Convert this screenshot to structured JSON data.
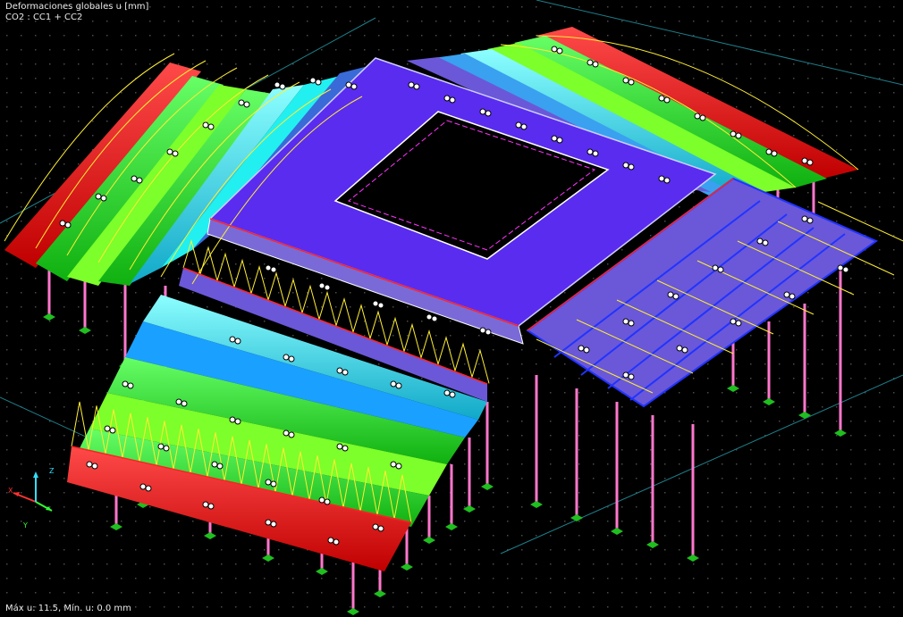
{
  "viewport": {
    "result_title": "Deformaciones globales u [mm]",
    "load_combination": "CO2 : CC1 + CC2",
    "status_readout": "Máx u: 11.5, Mín. u: 0.0 mm"
  },
  "axes_widget": {
    "x_label": "X",
    "y_label": "Y",
    "z_label": "Z"
  },
  "colors": {
    "background": "#000000",
    "grid_dot": "#4a4a4a",
    "guide_line": "#1e7f8a",
    "roof_blue": "#5a2cf0",
    "roof_violet": "#6a58d8",
    "deform_red": "#ff1a1a",
    "deform_green": "#22ff22",
    "deform_lime": "#7cff2a",
    "deform_cyan": "#22f0f0",
    "deform_sky": "#1aa0ff",
    "truss_yellow": "#ffee33",
    "column_pink": "#ff77cc",
    "support_green": "#1fbf1f",
    "member_red": "#ff2222",
    "axis_x": "#ff3333",
    "axis_y": "#33ff33",
    "axis_z": "#33ddff"
  }
}
